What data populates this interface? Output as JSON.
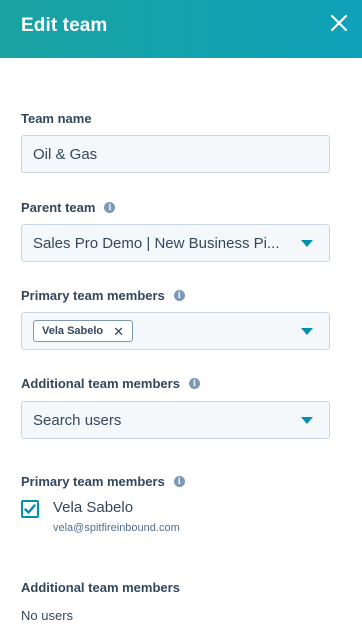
{
  "header": {
    "title": "Edit team",
    "close_icon": "close-icon",
    "gradient_start": "#19a2a1",
    "gradient_end": "#0ea1b8"
  },
  "team_name": {
    "label": "Team name",
    "value": "Oil & Gas"
  },
  "parent_team": {
    "label": "Parent team",
    "selected": "Sales Pro Demo | New Business Pi...",
    "info_icon": "info-icon"
  },
  "primary_members_select": {
    "label": "Primary team members",
    "tags": [
      "Vela Sabelo"
    ],
    "info_icon": "info-icon"
  },
  "additional_members_select": {
    "label": "Additional team members",
    "placeholder": "Search users",
    "info_icon": "info-icon"
  },
  "primary_members_list": {
    "label": "Primary team members",
    "members": [
      {
        "name": "Vela Sabelo",
        "email": "vela@spitfireinbound.com",
        "checked": true
      }
    ]
  },
  "additional_members_list": {
    "label": "Additional team members",
    "empty_text": "No users"
  },
  "colors": {
    "accent": "#0091ae",
    "text": "#33475b",
    "input_bg": "#f5f8fa",
    "input_border": "#cbd6e2"
  }
}
